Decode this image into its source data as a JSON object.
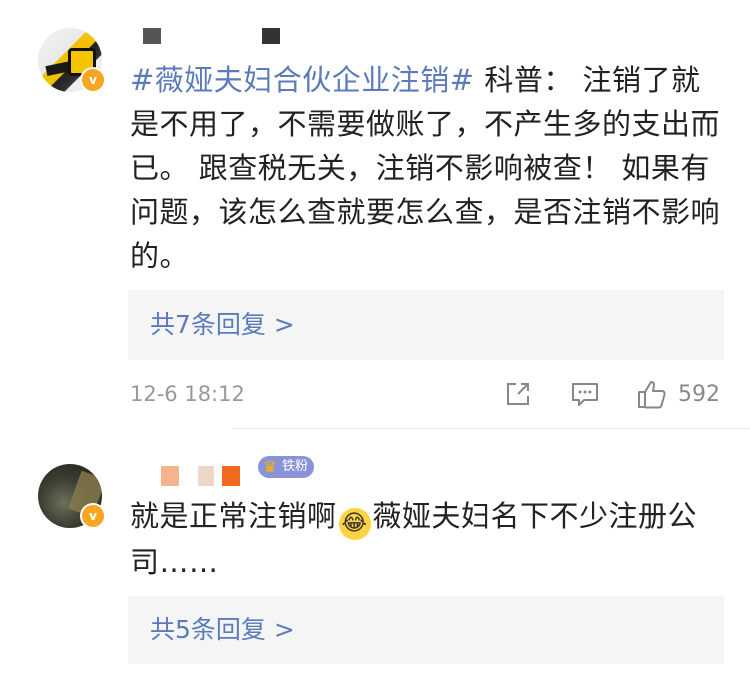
{
  "comments": [
    {
      "hashtag": "#薇娅夫妇合伙企业注销#",
      "text": " 科普： 注销了就是不用了，不需要做账了，不产生多的支出而已。 跟查税无关，注销不影响被查！ 如果有问题，该怎么查就要怎么查，是否注销不影响的。",
      "reply_link": "共7条回复 >",
      "timestamp": "12-6 18:12",
      "like_count": "592",
      "verified_icon": "verified-v-icon"
    },
    {
      "fan_badge": "铁粉",
      "text_before_emoji": "就是正常注销啊",
      "emoji": "laugh-cry-emoji",
      "text_after_emoji": "薇娅夫妇名下不少注册公司……",
      "reply_link": "共5条回复 >",
      "verified_icon": "verified-v-icon"
    }
  ],
  "colors": {
    "link": "#5b7bbb",
    "verified": "#f6a623",
    "fan_badge": "#8a93d8",
    "meta_text": "#999999",
    "reply_bg": "#f5f5f5"
  }
}
